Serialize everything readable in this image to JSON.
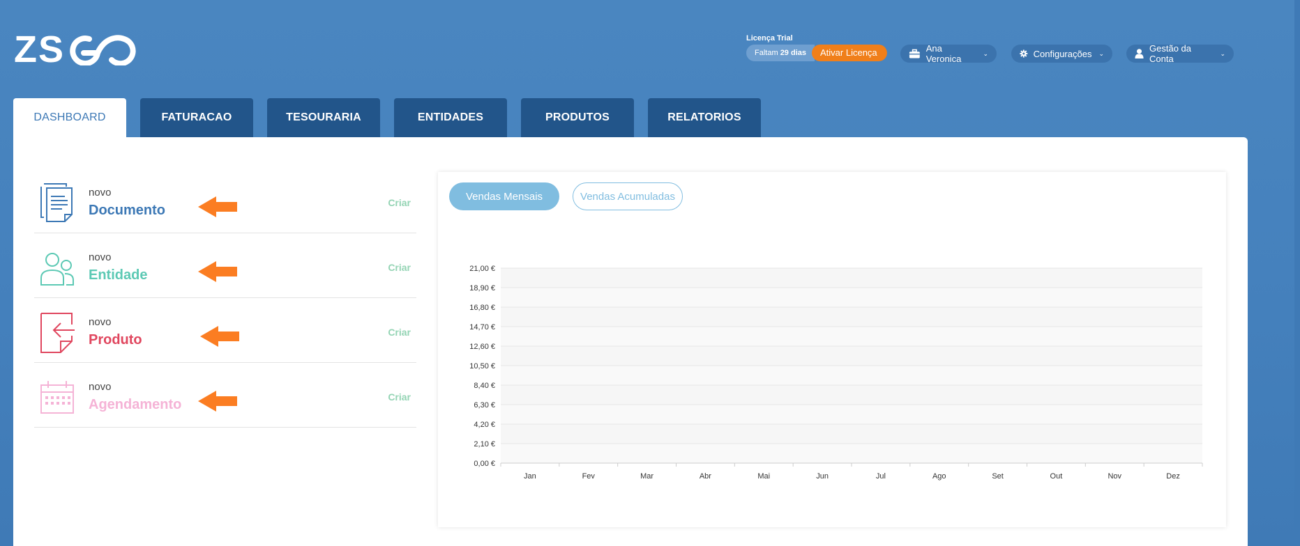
{
  "header": {
    "logo_text": "ZS GO",
    "license": {
      "label": "Licença Trial",
      "days_prefix": "Faltam",
      "days_count": "29 dias",
      "activate_label": "Ativar Licença"
    },
    "company_menu": {
      "label": "Ana Veronica",
      "icon": "briefcase-icon"
    },
    "settings_menu": {
      "label": "Configurações",
      "icon": "gear-icon"
    },
    "account_menu": {
      "label": "Gestão da Conta",
      "icon": "user-icon"
    }
  },
  "tabs": [
    {
      "label": "DASHBOARD",
      "active": true
    },
    {
      "label": "FATURACAO"
    },
    {
      "label": "TESOURARIA"
    },
    {
      "label": "ENTIDADES"
    },
    {
      "label": "PRODUTOS"
    },
    {
      "label": "RELATORIOS"
    }
  ],
  "quick_create": [
    {
      "small": "novo",
      "big": "Documento",
      "action": "Criar",
      "color": "#3c78b5",
      "icon": "document-icon"
    },
    {
      "small": "novo",
      "big": "Entidade",
      "action": "Criar",
      "color": "#5cc9b4",
      "icon": "users-icon"
    },
    {
      "small": "novo",
      "big": "Produto",
      "action": "Criar",
      "color": "#e0465e",
      "icon": "product-icon"
    },
    {
      "small": "novo",
      "big": "Agendamento",
      "action": "Criar",
      "color": "#f5b3d6",
      "icon": "calendar-icon"
    }
  ],
  "chart_toggle": {
    "monthly": "Vendas Mensais",
    "cumulative": "Vendas Acumuladas"
  },
  "colors": {
    "accent": "#3c78b5",
    "tab_bg": "#22558a",
    "license_orange": "#f07f1a",
    "arrow_orange": "#fb7d22",
    "create_green": "#94d4b4",
    "chart_blue": "#80bde0"
  },
  "chart_data": {
    "type": "bar",
    "categories": [
      "Jan",
      "Fev",
      "Mar",
      "Abr",
      "Mai",
      "Jun",
      "Jul",
      "Ago",
      "Set",
      "Out",
      "Nov",
      "Dez"
    ],
    "values": [
      0,
      0,
      0,
      0,
      0,
      0,
      0,
      0,
      0,
      0,
      0,
      0
    ],
    "y_ticks": [
      "0,00 €",
      "2,10 €",
      "4,20 €",
      "6,30 €",
      "8,40 €",
      "10,50 €",
      "12,60 €",
      "14,70 €",
      "16,80 €",
      "18,90 €",
      "21,00 €"
    ],
    "ylim": [
      0,
      21
    ],
    "grid": true
  }
}
